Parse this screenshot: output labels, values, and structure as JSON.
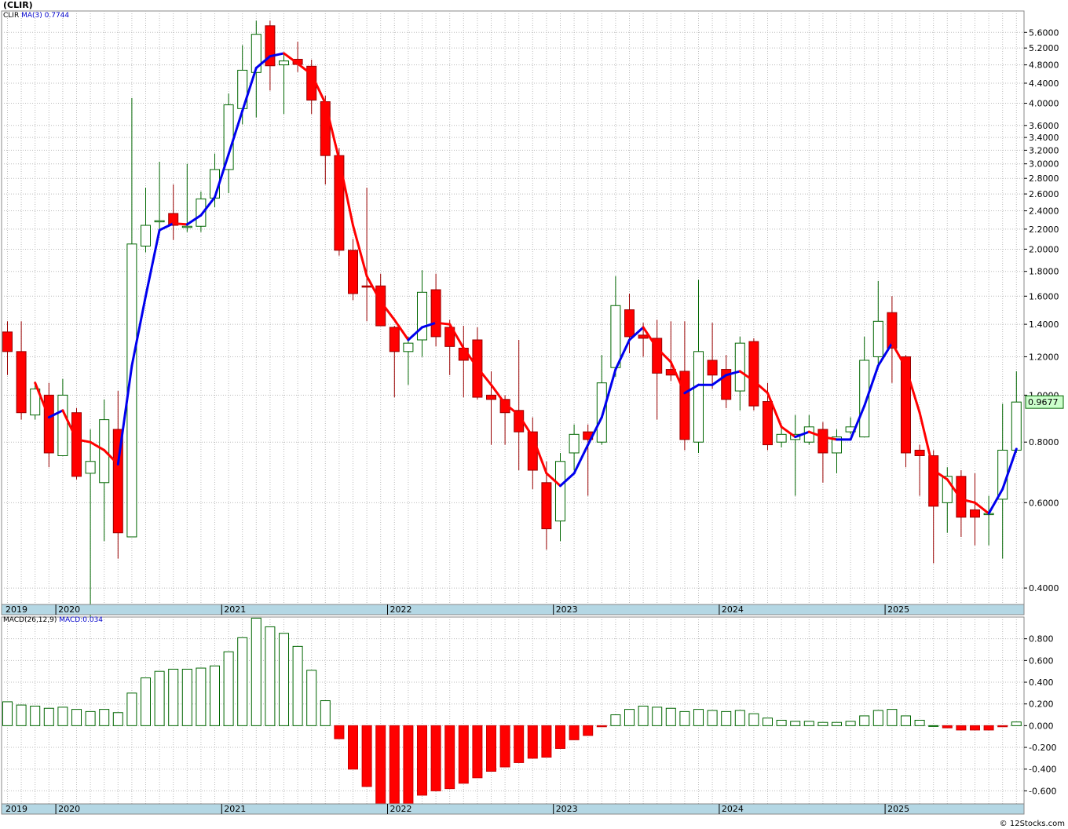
{
  "title": "(CLIR)",
  "legend_top": {
    "symbol": "CLIR",
    "ma_label": "MA(3)",
    "ma_value": "0.7744"
  },
  "legend_bottom": {
    "macd_label": "MACD(26,12,9)",
    "macd_value": "MACD:0.034"
  },
  "last_price_tag": "0.9677",
  "credit": "© 12Stocks.com",
  "colors": {
    "up_candle_stroke": "#006600",
    "down_candle_fill": "#ff0000",
    "ma_up": "#0000ee",
    "ma_down": "#ff0000",
    "macd_pos_stroke": "#006600",
    "macd_neg_fill": "#ff0000",
    "axis_band": "#b4d7e4",
    "grid": "#bbbbbb"
  },
  "chart_data": [
    {
      "type": "candlestick",
      "name": "price",
      "scale": "log",
      "ylim": [
        0.37,
        6.2
      ],
      "y_ticks": [
        "0.4000",
        "0.6000",
        "0.8000",
        "1.0000",
        "1.2000",
        "1.4000",
        "1.6000",
        "1.8000",
        "2.0000",
        "2.2000",
        "2.4000",
        "2.6000",
        "2.8000",
        "3.0000",
        "3.2000",
        "3.4000",
        "3.6000",
        "4.0000",
        "4.4000",
        "4.8000",
        "5.2000",
        "5.6000"
      ],
      "x_labels": [
        "2019",
        "2020",
        "2021",
        "2022",
        "2023",
        "2024",
        "2025"
      ],
      "months": [
        "2019-09",
        "2019-10",
        "2019-11",
        "2019-12",
        "2020-01",
        "2020-02",
        "2020-03",
        "2020-04",
        "2020-05",
        "2020-06",
        "2020-07",
        "2020-08",
        "2020-09",
        "2020-10",
        "2020-11",
        "2020-12",
        "2021-01",
        "2021-02",
        "2021-03",
        "2021-04",
        "2021-05",
        "2021-06",
        "2021-07",
        "2021-08",
        "2021-09",
        "2021-10",
        "2021-11",
        "2021-12",
        "2022-01",
        "2022-02",
        "2022-03",
        "2022-04",
        "2022-05",
        "2022-06",
        "2022-07",
        "2022-08",
        "2022-09",
        "2022-10",
        "2022-11",
        "2022-12",
        "2023-01",
        "2023-02",
        "2023-03",
        "2023-04",
        "2023-05",
        "2023-06",
        "2023-07",
        "2023-08",
        "2023-09",
        "2023-10",
        "2023-11",
        "2023-12",
        "2024-01",
        "2024-02",
        "2024-03",
        "2024-04",
        "2024-05",
        "2024-06",
        "2024-07",
        "2024-08",
        "2024-09",
        "2024-10",
        "2024-11",
        "2024-12",
        "2025-01",
        "2025-02",
        "2025-03",
        "2025-04",
        "2025-05",
        "2025-06",
        "2025-07",
        "2025-08",
        "2025-09",
        "2025-10"
      ],
      "ohlc": [
        [
          1.35,
          1.42,
          1.1,
          1.23
        ],
        [
          1.23,
          1.42,
          0.89,
          0.92
        ],
        [
          0.91,
          1.06,
          0.89,
          1.03
        ],
        [
          1.0,
          1.06,
          0.71,
          0.76
        ],
        [
          0.75,
          1.08,
          0.75,
          1.0
        ],
        [
          0.92,
          0.94,
          0.67,
          0.68
        ],
        [
          0.69,
          0.85,
          0.34,
          0.73
        ],
        [
          0.66,
          0.98,
          0.5,
          0.89
        ],
        [
          0.85,
          1.02,
          0.46,
          0.52
        ],
        [
          0.51,
          4.1,
          0.51,
          2.05
        ],
        [
          2.03,
          2.68,
          1.97,
          2.24
        ],
        [
          2.28,
          3.03,
          2.17,
          2.29
        ],
        [
          2.37,
          2.72,
          2.09,
          2.24
        ],
        [
          2.22,
          3.0,
          2.17,
          2.23
        ],
        [
          2.23,
          2.63,
          2.17,
          2.54
        ],
        [
          2.55,
          3.15,
          2.44,
          2.92
        ],
        [
          2.92,
          4.19,
          2.61,
          3.97
        ],
        [
          3.9,
          5.27,
          3.62,
          4.68
        ],
        [
          4.63,
          5.92,
          3.74,
          5.55
        ],
        [
          5.78,
          5.92,
          4.25,
          4.78
        ],
        [
          4.8,
          5.08,
          3.8,
          4.89
        ],
        [
          4.93,
          5.36,
          4.64,
          4.81
        ],
        [
          4.77,
          4.92,
          3.8,
          4.06
        ],
        [
          4.03,
          4.15,
          2.72,
          3.12
        ],
        [
          3.12,
          3.23,
          1.94,
          1.99
        ],
        [
          1.99,
          2.1,
          1.57,
          1.62
        ],
        [
          1.68,
          2.68,
          1.42,
          1.67
        ],
        [
          1.68,
          1.78,
          1.39,
          1.39
        ],
        [
          1.38,
          1.39,
          0.99,
          1.23
        ],
        [
          1.23,
          1.32,
          1.05,
          1.28
        ],
        [
          1.3,
          1.81,
          1.2,
          1.63
        ],
        [
          1.65,
          1.78,
          1.26,
          1.32
        ],
        [
          1.38,
          1.43,
          1.1,
          1.26
        ],
        [
          1.25,
          1.39,
          0.99,
          1.18
        ],
        [
          1.3,
          1.38,
          0.98,
          0.99
        ],
        [
          1.0,
          1.12,
          0.79,
          0.98
        ],
        [
          0.98,
          1.0,
          0.79,
          0.92
        ],
        [
          0.93,
          1.3,
          0.7,
          0.84
        ],
        [
          0.84,
          0.9,
          0.64,
          0.7
        ],
        [
          0.66,
          0.73,
          0.48,
          0.53
        ],
        [
          0.55,
          0.76,
          0.5,
          0.73
        ],
        [
          0.76,
          0.87,
          0.7,
          0.83
        ],
        [
          0.84,
          0.87,
          0.62,
          0.81
        ],
        [
          0.8,
          1.21,
          0.79,
          1.06
        ],
        [
          1.14,
          1.76,
          1.09,
          1.53
        ],
        [
          1.5,
          1.62,
          1.22,
          1.32
        ],
        [
          1.33,
          1.41,
          1.2,
          1.31
        ],
        [
          1.31,
          1.43,
          0.89,
          1.11
        ],
        [
          1.13,
          1.42,
          1.07,
          1.1
        ],
        [
          1.12,
          1.42,
          0.77,
          0.81
        ],
        [
          0.8,
          1.73,
          0.76,
          1.23
        ],
        [
          1.18,
          1.41,
          1.03,
          1.1
        ],
        [
          1.13,
          1.21,
          0.94,
          0.98
        ],
        [
          1.02,
          1.32,
          0.93,
          1.28
        ],
        [
          1.29,
          1.31,
          0.93,
          0.95
        ],
        [
          0.97,
          1.06,
          0.77,
          0.79
        ],
        [
          0.8,
          0.86,
          0.78,
          0.83
        ],
        [
          0.81,
          0.91,
          0.62,
          0.83
        ],
        [
          0.8,
          0.91,
          0.79,
          0.86
        ],
        [
          0.85,
          0.88,
          0.66,
          0.76
        ],
        [
          0.76,
          0.85,
          0.69,
          0.82
        ],
        [
          0.84,
          0.9,
          0.83,
          0.86
        ],
        [
          0.82,
          1.32,
          0.82,
          1.18
        ],
        [
          1.2,
          1.72,
          1.15,
          1.42
        ],
        [
          1.48,
          1.6,
          1.06,
          1.25
        ],
        [
          1.2,
          1.21,
          0.71,
          0.76
        ],
        [
          0.77,
          0.79,
          0.62,
          0.75
        ],
        [
          0.75,
          0.77,
          0.45,
          0.59
        ],
        [
          0.6,
          0.71,
          0.52,
          0.68
        ],
        [
          0.68,
          0.7,
          0.51,
          0.56
        ],
        [
          0.58,
          0.69,
          0.49,
          0.56
        ],
        [
          0.57,
          0.62,
          0.49,
          0.57
        ],
        [
          0.61,
          0.96,
          0.46,
          0.77
        ],
        [
          0.77,
          1.12,
          0.76,
          0.9677
        ]
      ],
      "ma3": [
        null,
        null,
        1.06,
        0.9,
        0.93,
        0.81,
        0.8,
        0.77,
        0.72,
        1.15,
        1.6,
        2.19,
        2.26,
        2.25,
        2.35,
        2.56,
        3.14,
        3.86,
        4.73,
        5.0,
        5.07,
        4.83,
        4.59,
        4.0,
        3.06,
        2.24,
        1.76,
        1.56,
        1.43,
        1.3,
        1.38,
        1.41,
        1.4,
        1.25,
        1.14,
        1.05,
        0.96,
        0.91,
        0.82,
        0.69,
        0.65,
        0.69,
        0.79,
        0.9,
        1.13,
        1.3,
        1.38,
        1.25,
        1.17,
        1.01,
        1.05,
        1.05,
        1.1,
        1.12,
        1.07,
        1.01,
        0.86,
        0.82,
        0.84,
        0.82,
        0.81,
        0.81,
        0.95,
        1.15,
        1.28,
        1.14,
        0.92,
        0.7,
        0.67,
        0.61,
        0.6,
        0.57,
        0.64,
        0.7744
      ]
    },
    {
      "type": "bar",
      "name": "MACD(26,12,9)",
      "ylim": [
        -0.72,
        1.0
      ],
      "y_ticks": [
        "-0.600",
        "-0.400",
        "-0.200",
        "0.000",
        "0.200",
        "0.400",
        "0.600",
        "0.800"
      ],
      "x_labels": [
        "2019",
        "2020",
        "2021",
        "2022",
        "2023",
        "2024",
        "2025"
      ],
      "values": [
        0.22,
        0.19,
        0.18,
        0.16,
        0.17,
        0.15,
        0.13,
        0.15,
        0.12,
        0.3,
        0.44,
        0.5,
        0.52,
        0.52,
        0.53,
        0.55,
        0.68,
        0.81,
        0.99,
        0.91,
        0.85,
        0.73,
        0.51,
        0.23,
        -0.12,
        -0.4,
        -0.56,
        -0.72,
        -0.77,
        -0.73,
        -0.64,
        -0.6,
        -0.58,
        -0.53,
        -0.48,
        -0.42,
        -0.38,
        -0.34,
        -0.3,
        -0.29,
        -0.21,
        -0.13,
        -0.09,
        -0.01,
        0.1,
        0.15,
        0.18,
        0.17,
        0.16,
        0.13,
        0.15,
        0.14,
        0.13,
        0.14,
        0.11,
        0.07,
        0.05,
        0.04,
        0.04,
        0.03,
        0.03,
        0.04,
        0.09,
        0.14,
        0.15,
        0.09,
        0.05,
        0.0,
        -0.02,
        -0.04,
        -0.04,
        -0.04,
        -0.01,
        0.034
      ]
    }
  ]
}
